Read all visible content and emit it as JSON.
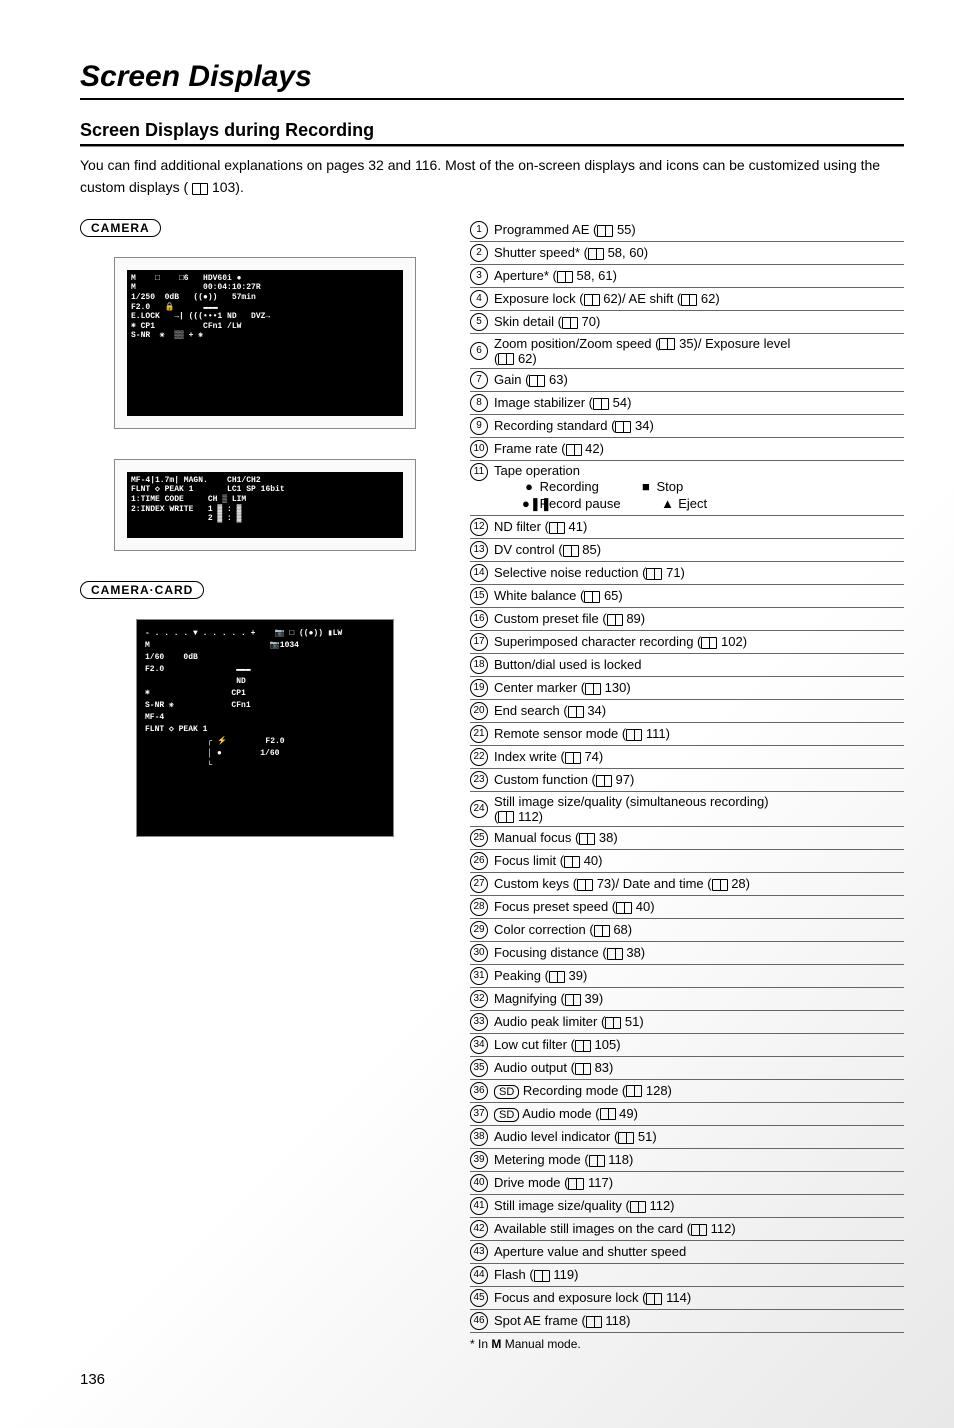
{
  "titles": {
    "main": "Screen Displays",
    "sub": "Screen Displays during Recording"
  },
  "intro": "You can find additional explanations on pages 32 and 116. Most of the on-screen displays and icons can be customized using the custom displays (",
  "intro_ref": "103).",
  "modes": {
    "camera": "CAMERA",
    "camera_card": "CAMERA·CARD"
  },
  "diagram1_text": "M    □    □6   HDV60i ●\nM              00:04:10:27R\n1/250  0dB   ((●))   57min\nF2.0   🔒      ▬▬▬\nE.LOCK   →| (((•••1 ND   DVZ→\n☀ CP1          CFn1 /LW\nS-NR  ✳  ▒▒ + ✳",
  "diagram1b_text": "MF-4|1.7m| MAGN.    CH1/CH2\nFLNT ◇ PEAK 1       LC1 SP 16bit\n1:TIME CODE     CH ▒ LIM\n2:INDEX WRITE   1 ▓ : ▓\n                2 ▓ : ▓",
  "diagram2_text": "- . . . . ▼ . . . . . +    📷 □ ((●)) ▮LW\nM                         📷1034\n1/60    0dB\nF2.0               ▬▬▬\n                   ND\n☀                 CP1\nS-NR ✳            CFn1\nMF-4\nFLNT ◇ PEAK 1\n             ┌ ⚡        F2.0\n             │ ●        1/60\n             └",
  "tape": {
    "title": "Tape operation",
    "recording": "Recording",
    "stop": "Stop",
    "pause": "Record pause",
    "eject": "Eject"
  },
  "legend": [
    {
      "n": "1",
      "text": "Programmed AE",
      "refs": [
        "55"
      ]
    },
    {
      "n": "2",
      "text": "Shutter speed*",
      "refs": [
        "58, 60"
      ]
    },
    {
      "n": "3",
      "text": "Aperture*",
      "refs": [
        "58, 61"
      ]
    },
    {
      "n": "4",
      "text": "Exposure lock",
      "refs": [
        "62"
      ],
      "text2": "/ AE shift",
      "refs2": [
        "62"
      ]
    },
    {
      "n": "5",
      "text": "Skin detail",
      "refs": [
        "70"
      ]
    },
    {
      "n": "6",
      "text": "Zoom position/Zoom speed",
      "refs": [
        "35"
      ],
      "text2": "/ Exposure level",
      "refs2": [
        "62"
      ],
      "wrap": true
    },
    {
      "n": "7",
      "text": "Gain",
      "refs": [
        "63"
      ]
    },
    {
      "n": "8",
      "text": "Image stabilizer",
      "refs": [
        "54"
      ]
    },
    {
      "n": "9",
      "text": "Recording standard",
      "refs": [
        "34"
      ]
    },
    {
      "n": "10",
      "text": "Frame rate",
      "refs": [
        "42"
      ]
    },
    {
      "n": "11",
      "tape": true
    },
    {
      "n": "12",
      "text": "ND filter",
      "refs": [
        "41"
      ]
    },
    {
      "n": "13",
      "text": "DV control",
      "refs": [
        "85"
      ]
    },
    {
      "n": "14",
      "text": "Selective noise reduction",
      "refs": [
        "71"
      ]
    },
    {
      "n": "15",
      "text": "White balance",
      "refs": [
        "65"
      ]
    },
    {
      "n": "16",
      "text": "Custom preset file",
      "refs": [
        "89"
      ]
    },
    {
      "n": "17",
      "text": "Superimposed character recording",
      "refs": [
        "102"
      ]
    },
    {
      "n": "18",
      "text": "Button/dial used is locked"
    },
    {
      "n": "19",
      "text": "Center marker",
      "refs": [
        "130"
      ]
    },
    {
      "n": "20",
      "text": "End search",
      "refs": [
        "34"
      ]
    },
    {
      "n": "21",
      "text": "Remote sensor mode",
      "refs": [
        "111"
      ]
    },
    {
      "n": "22",
      "text": "Index write",
      "refs": [
        "74"
      ]
    },
    {
      "n": "23",
      "text": "Custom function",
      "refs": [
        "97"
      ]
    },
    {
      "n": "24",
      "text": "Still image size/quality (simultaneous recording)",
      "refs": [
        "112"
      ],
      "wrap": true
    },
    {
      "n": "25",
      "text": "Manual focus",
      "refs": [
        "38"
      ]
    },
    {
      "n": "26",
      "text": "Focus limit",
      "refs": [
        "40"
      ]
    },
    {
      "n": "27",
      "text": "Custom keys",
      "refs": [
        "73"
      ],
      "text2": "/ Date and time",
      "refs2": [
        "28"
      ]
    },
    {
      "n": "28",
      "text": "Focus preset speed",
      "refs": [
        "40"
      ]
    },
    {
      "n": "29",
      "text": "Color correction",
      "refs": [
        "68"
      ]
    },
    {
      "n": "30",
      "text": "Focusing distance",
      "refs": [
        "38"
      ]
    },
    {
      "n": "31",
      "text": "Peaking",
      "refs": [
        "39"
      ]
    },
    {
      "n": "32",
      "text": "Magnifying",
      "refs": [
        "39"
      ]
    },
    {
      "n": "33",
      "text": "Audio peak limiter",
      "refs": [
        "51"
      ]
    },
    {
      "n": "34",
      "text": "Low cut filter",
      "refs": [
        "105"
      ]
    },
    {
      "n": "35",
      "text": "Audio output",
      "refs": [
        "83"
      ]
    },
    {
      "n": "36",
      "sd": true,
      "text": "Recording mode",
      "refs": [
        "128"
      ]
    },
    {
      "n": "37",
      "sd": true,
      "text": "Audio mode",
      "refs": [
        "49"
      ]
    },
    {
      "n": "38",
      "text": "Audio level indicator",
      "refs": [
        "51"
      ]
    },
    {
      "n": "39",
      "text": "Metering mode",
      "refs": [
        "118"
      ]
    },
    {
      "n": "40",
      "text": "Drive mode",
      "refs": [
        "117"
      ]
    },
    {
      "n": "41",
      "text": "Still image size/quality",
      "refs": [
        "112"
      ]
    },
    {
      "n": "42",
      "text": "Available still images on the card",
      "refs": [
        "112"
      ]
    },
    {
      "n": "43",
      "text": "Aperture value and shutter speed"
    },
    {
      "n": "44",
      "text": "Flash",
      "refs": [
        "119"
      ]
    },
    {
      "n": "45",
      "text": "Focus and exposure lock",
      "refs": [
        "114"
      ]
    },
    {
      "n": "46",
      "text": "Spot AE frame",
      "refs": [
        "118"
      ]
    }
  ],
  "footnote_prefix": "* In ",
  "footnote_bold": "M",
  "footnote_suffix": " Manual mode.",
  "page_number": "136",
  "sd_label": "SD"
}
